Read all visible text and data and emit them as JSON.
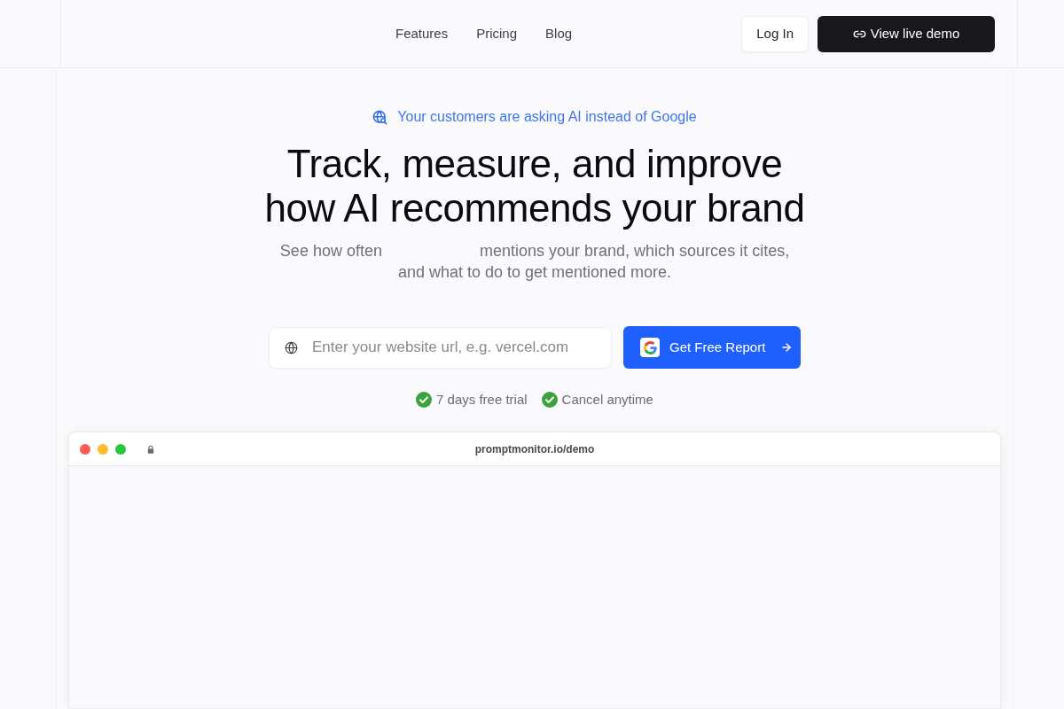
{
  "nav": {
    "links": [
      {
        "label": "Features"
      },
      {
        "label": "Pricing"
      },
      {
        "label": "Blog"
      }
    ],
    "buttons": [
      {
        "kind": "secondary",
        "label": "Log In"
      },
      {
        "kind": "primary",
        "label": "View live demo"
      }
    ]
  },
  "hero": {
    "eyebrow": "Your customers are asking AI instead of Google",
    "heading_lines": [
      "Track, measure, and improve",
      "how AI recommends your brand"
    ],
    "subtitle_segments": [
      "See how often",
      "mentions your brand, which sources it cites,",
      "and what to do to get mentioned more."
    ]
  },
  "signup_form": {
    "placeholder": "Enter your website url, e.g. vercel.com",
    "button": "Get Free Report"
  },
  "perks": [
    "7 days free trial",
    "Cancel anytime"
  ],
  "browser_preview": {
    "dots": [
      {
        "color": "#ff5f57"
      },
      {
        "color": "#febc2e"
      },
      {
        "color": "#28c840"
      }
    ],
    "url": "promptmonitor.io/demo"
  }
}
